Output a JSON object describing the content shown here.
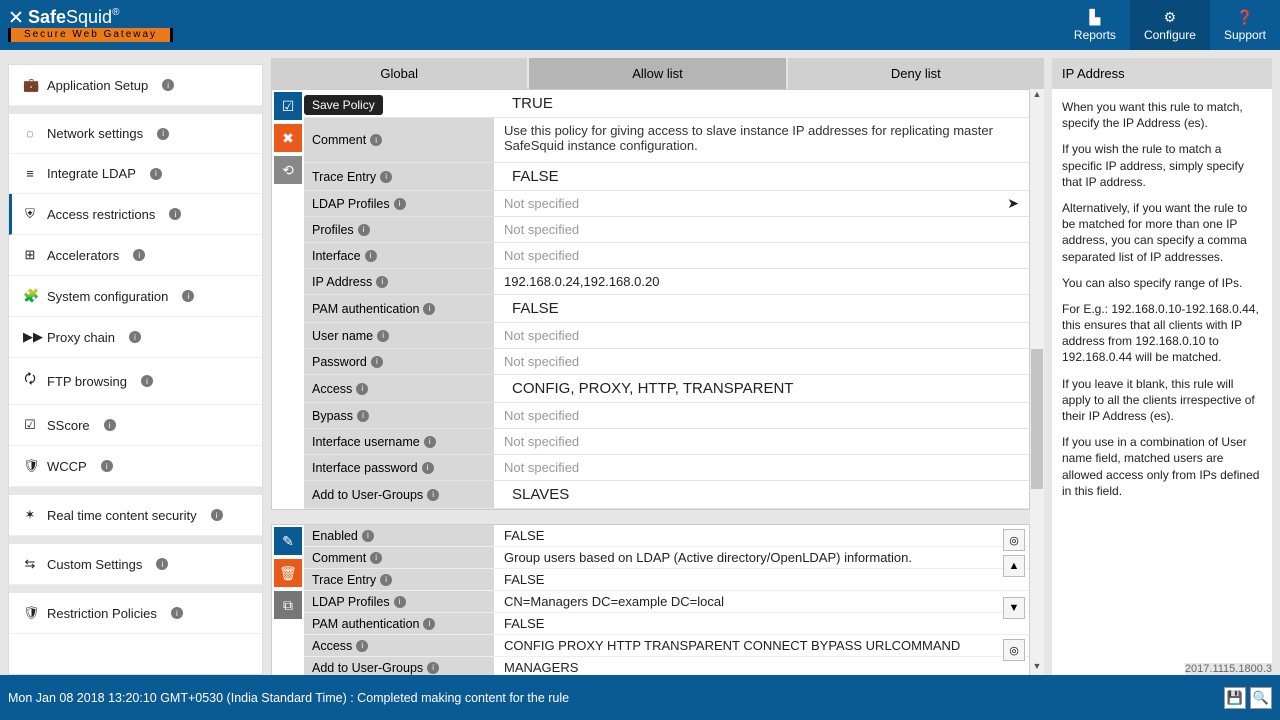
{
  "brand": {
    "name_a": "Safe",
    "name_b": "Squid",
    "reg": "®",
    "tag": "Secure Web Gateway"
  },
  "topnav": {
    "reports": "Reports",
    "configure": "Configure",
    "support": "Support"
  },
  "sidebar": {
    "items": [
      {
        "icon": "💼",
        "label": "Application Setup"
      },
      {
        "icon": "◌",
        "label": "Network settings"
      },
      {
        "icon": "≡",
        "label": "Integrate LDAP"
      },
      {
        "icon": "⛨",
        "label": "Access restrictions"
      },
      {
        "icon": "⊞",
        "label": "Accelerators"
      },
      {
        "icon": "🧩",
        "label": "System configuration"
      },
      {
        "icon": "▶▶",
        "label": "Proxy chain"
      },
      {
        "icon": "🗘",
        "label": "FTP browsing"
      },
      {
        "icon": "☑",
        "label": "SScore"
      },
      {
        "icon": "🛡",
        "label": "WCCP"
      },
      {
        "icon": "✶",
        "label": "Real time content security"
      },
      {
        "icon": "⇆",
        "label": "Custom Settings"
      },
      {
        "icon": "🛡",
        "label": "Restriction Policies"
      }
    ]
  },
  "tabs": {
    "global": "Global",
    "allow": "Allow list",
    "deny": "Deny list"
  },
  "tooltip": "Save Policy",
  "p1": {
    "true": "TRUE",
    "comment_l": "Comment",
    "comment_v": "Use this policy for giving access to slave instance IP addresses for replicating master SafeSquid instance configuration.",
    "trace_l": "Trace Entry",
    "trace_v": "FALSE",
    "ldap_l": "LDAP Profiles",
    "ns": "Not specified",
    "profiles_l": "Profiles",
    "interface_l": "Interface",
    "ip_l": "IP Address",
    "ip_v": "192.168.0.24,192.168.0.20",
    "pam_l": "PAM authentication",
    "pam_v": "FALSE",
    "user_l": "User name",
    "pass_l": "Password",
    "access_l": "Access",
    "access_v": "CONFIG,  PROXY,  HTTP,  TRANSPARENT",
    "bypass_l": "Bypass",
    "iuser_l": "Interface username",
    "ipass_l": "Interface password",
    "groups_l": "Add to User-Groups",
    "groups_v": "SLAVES"
  },
  "p2": {
    "enabled_l": "Enabled",
    "enabled_v": "FALSE",
    "comment_l": "Comment",
    "comment_v": "Group users based on LDAP (Active directory/OpenLDAP) information.",
    "trace_l": "Trace Entry",
    "trace_v": "FALSE",
    "ldap_l": "LDAP Profiles",
    "ldap_v": "CN=Managers DC=example DC=local",
    "pam_l": "PAM authentication",
    "pam_v": "FALSE",
    "access_l": "Access",
    "access_v": "CONFIG  PROXY  HTTP  TRANSPARENT  CONNECT  BYPASS  URLCOMMAND",
    "groups_l": "Add to User-Groups",
    "groups_v": "MANAGERS"
  },
  "help": {
    "title": "IP Address",
    "p1": "When you want this rule to match, specify the IP Address (es).",
    "p2": "If you wish the rule to match a specific IP address, simply specify that IP address.",
    "p3": "Alternatively, if you want the rule to be matched for more than one IP address, you can specify a comma separated list of IP addresses.",
    "p4": "You can also specify range of IPs.",
    "p5": "For E.g.: 192.168.0.10-192.168.0.44, this ensures that all clients with IP address from 192.168.0.10 to 192.168.0.44 will be matched.",
    "p6": "If you leave it blank, this rule will apply to all the clients irrespective of their IP Address (es).",
    "p7": "If you use in a combination of User name field, matched users are allowed access only from IPs defined in this field."
  },
  "footer": {
    "status": "Mon Jan 08 2018 13:20:10 GMT+0530 (India Standard Time) : Completed making content for the rule",
    "version": "2017.1115.1800.3"
  }
}
